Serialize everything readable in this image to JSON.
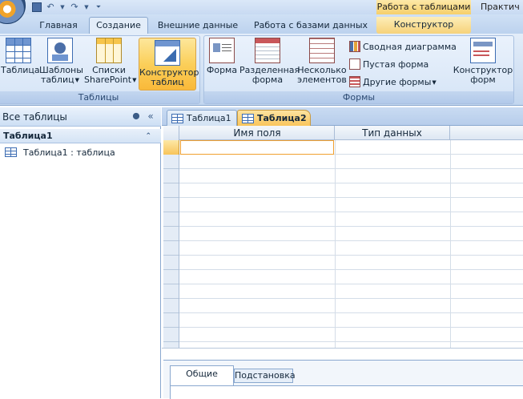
{
  "titlebar": {
    "context_header": "Работа с таблицами",
    "window_title": "Практич"
  },
  "ribbon_tabs": [
    "Главная",
    "Создание",
    "Внешние данные",
    "Работа с базами данных",
    "Конструктор"
  ],
  "active_tab": "Создание",
  "groups": {
    "tables": {
      "label": "Таблицы",
      "buttons": [
        {
          "line1": "Таблица",
          "line2": ""
        },
        {
          "line1": "Шаблоны",
          "line2": "таблиц"
        },
        {
          "line1": "Списки",
          "line2": "SharePoint"
        },
        {
          "line1": "Конструктор",
          "line2": "таблиц"
        }
      ]
    },
    "forms": {
      "label": "Формы",
      "buttons": [
        {
          "line1": "Форма",
          "line2": ""
        },
        {
          "line1": "Разделенная",
          "line2": "форма"
        },
        {
          "line1": "Несколько",
          "line2": "элементов"
        },
        {
          "line1": "Конструктор",
          "line2": "форм"
        }
      ],
      "small_buttons": [
        "Сводная диаграмма",
        "Пустая форма",
        "Другие формы"
      ]
    }
  },
  "nav_pane": {
    "header": "Все таблицы",
    "group": "Таблица1",
    "items": [
      "Таблица1 : таблица"
    ]
  },
  "doc_tabs": [
    "Таблица1",
    "Таблица2"
  ],
  "grid": {
    "columns": [
      "Имя поля",
      "Тип данных"
    ]
  },
  "props_tabs": [
    "Общие",
    "Подстановка"
  ]
}
